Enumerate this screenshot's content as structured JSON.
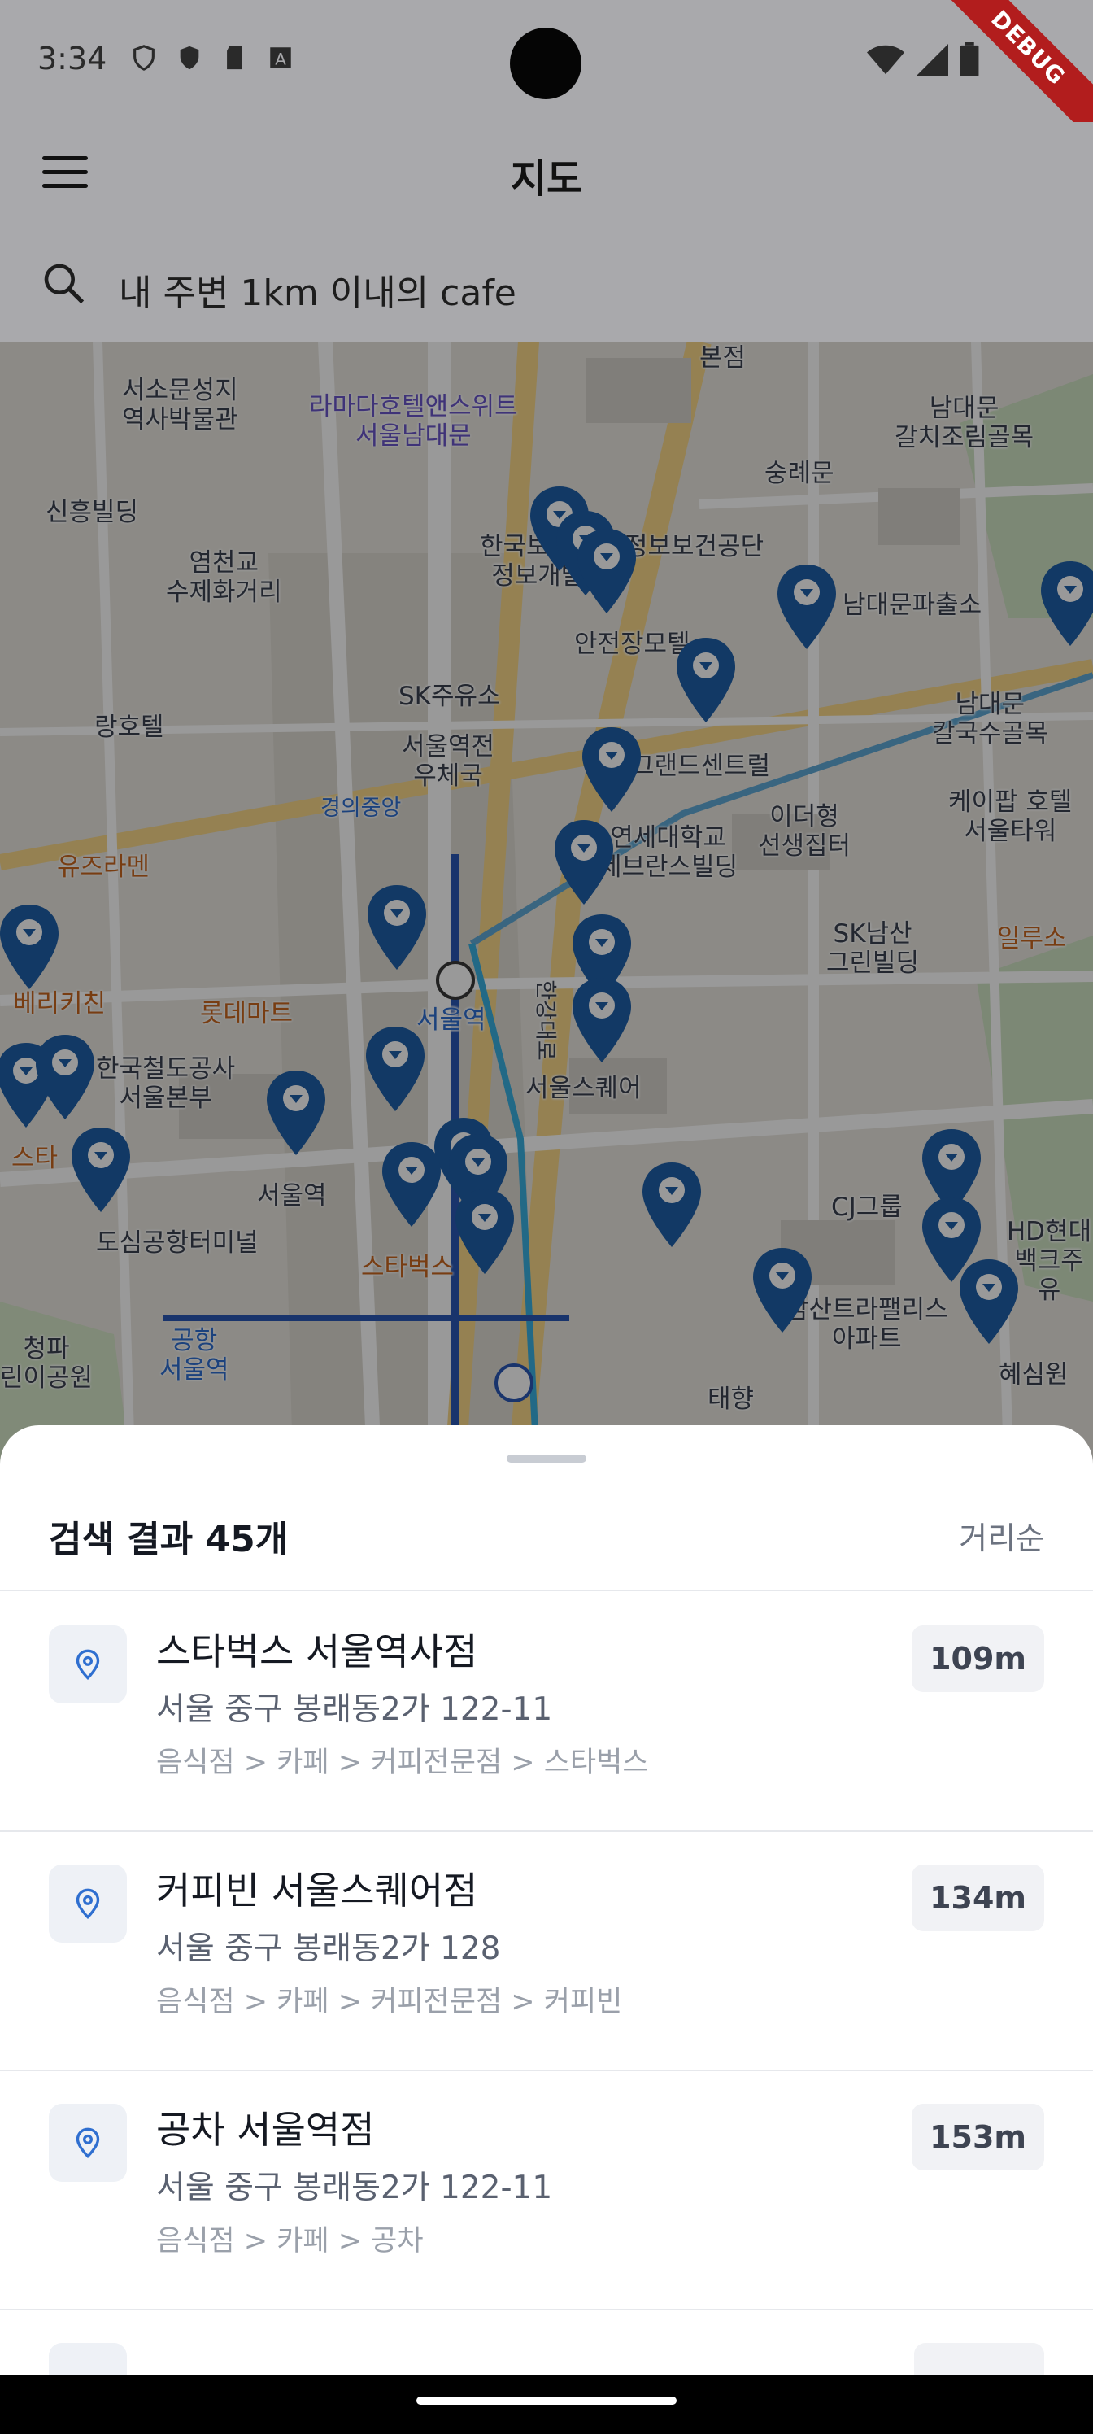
{
  "status": {
    "time": "3:34",
    "debug": "DEBUG"
  },
  "app": {
    "title": "지도"
  },
  "search": {
    "query": "내 주변 1km 이내의 cafe"
  },
  "map": {
    "labels": {
      "seosomun": "서소문성지\n역사박물관",
      "ramada": "라마다호텔앤스위트\n서울남대문",
      "namdaemun_tool": "남대문\n갈치조림골목",
      "sungnyemun": "숭례문",
      "sinheung": "신흥빌딩",
      "yeomcheon": "염천교\n수제화거리",
      "korea_health": "한국보건복지\n정보개발원",
      "cheongbo": "정보보건공단",
      "safety_hq": "안전장모텔",
      "namdaemun_police": "남대문파출소",
      "sk_gas": "SK주유소",
      "rang_hotel": "랑호텔",
      "seoul_post": "서울역전\n우체국",
      "grand_center": "그랜드센트럴",
      "namdaemun_noodle": "남대문\n칼국수골목",
      "kpop_hotel": "케이팝 호텔\n서울타워",
      "ideohyeong": "이더형\n선생집터",
      "yonsei_severance": "연세대학교\n세브란스빌딩",
      "gyeongui": "경의중앙",
      "sk_namsan": "SK남산\n그린빌딩",
      "yuzu_ramen": "유즈라멘",
      "berry_chicken": "베리키친",
      "lotte_mart": "롯데마트",
      "seoul_station": "서울역",
      "korea_rail": "한국철도공사\n서울본부",
      "seoul_square": "서울스퀘어",
      "ilruso": "일루소",
      "starbucks": "스타벅스",
      "seoul_station2": "서울역",
      "dosim_airport": "도심공항터미널",
      "cj_group": "CJ그룹",
      "namsan_trapalace": "남산트라팰리스\n아파트",
      "hyundai": "HD현대\n백크주유",
      "hyesimwon": "혜심원",
      "taehyang": "태향",
      "cheongpa": "청파\n린이공원",
      "airport_line": "공항\n서울역",
      "bonjeon": "본점",
      "yongsan_road": "한강대로",
      "starbucks_left": "스타"
    }
  },
  "sheet": {
    "result_count": "검색 결과 45개",
    "sort": "거리순",
    "results": [
      {
        "name": "스타벅스 서울역사점",
        "address": "서울 중구 봉래동2가 122-11",
        "category": "음식점 > 카페 > 커피전문점 > 스타벅스",
        "distance": "109m"
      },
      {
        "name": "커피빈 서울스퀘어점",
        "address": "서울 중구 봉래동2가 128",
        "category": "음식점 > 카페 > 커피전문점 > 커피빈",
        "distance": "134m"
      },
      {
        "name": "공차 서울역점",
        "address": "서울 중구 봉래동2가 122-11",
        "category": "음식점 > 카페 > 공차",
        "distance": "153m"
      },
      {
        "name": "",
        "address": "",
        "category": "",
        "distance": ""
      }
    ]
  },
  "colors": {
    "pin": "#1e5fa8",
    "accent": "#2f6fd0"
  }
}
